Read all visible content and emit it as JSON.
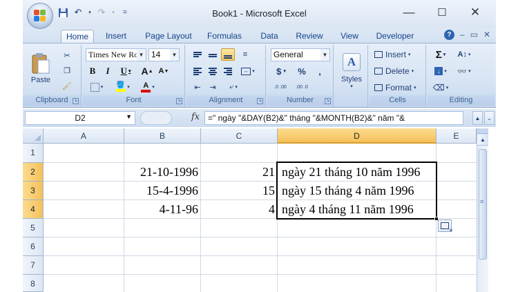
{
  "window": {
    "title": "Book1 - Microsoft Excel",
    "minimize": "—",
    "maximize": "☐",
    "close": "✕"
  },
  "quick_access": {
    "save_icon": "save-icon",
    "undo_icon": "undo-icon",
    "redo_icon": "redo-icon",
    "customize": "="
  },
  "tabs": [
    "Home",
    "Insert",
    "Page Layout",
    "Formulas",
    "Data",
    "Review",
    "View",
    "Developer"
  ],
  "active_tab": "Home",
  "ribbon_controls": {
    "help": "?",
    "minimize": "–",
    "restore": "▭",
    "close": "✕"
  },
  "ribbon": {
    "clipboard": {
      "label": "Clipboard",
      "paste": "Paste",
      "cut_icon": "cut-icon",
      "copy_icon": "copy-icon",
      "format_painter_icon": "format-painter-icon"
    },
    "font": {
      "label": "Font",
      "font_name": "Times New Ro",
      "font_size": "14",
      "bold": "B",
      "italic": "I",
      "underline": "U",
      "grow": "A",
      "shrink": "A"
    },
    "alignment": {
      "label": "Alignment"
    },
    "number": {
      "label": "Number",
      "format": "General",
      "currency": "$",
      "percent": "%",
      "comma": ",",
      "inc_decimal": ".0 .00",
      "dec_decimal": ".00 .0"
    },
    "styles": {
      "label": "Styles"
    },
    "cells": {
      "label": "Cells",
      "insert": "Insert",
      "delete": "Delete",
      "format": "Format"
    },
    "editing": {
      "label": "Editing",
      "sum": "Σ"
    }
  },
  "formula_bar": {
    "name_box": "D2",
    "fx": "fx",
    "formula": "=\" ngày \"&DAY(B2)&\" tháng \"&MONTH(B2)&\" năm \"&"
  },
  "grid": {
    "columns": [
      "A",
      "B",
      "C",
      "D",
      "E"
    ],
    "rows": [
      "1",
      "2",
      "3",
      "4",
      "5",
      "6",
      "7",
      "8"
    ],
    "selected_column": "D",
    "selected_rows": [
      "2",
      "3",
      "4"
    ],
    "cells": {
      "B2": "21-10-1996",
      "C2": "21",
      "D2": "ngày 21 tháng 10 năm 1996",
      "B3": "15-4-1996",
      "C3": "15",
      "D3": "ngày 15 tháng 4 năm 1996",
      "B4": "4-11-96",
      "C4": "4",
      "D4": "ngày 4 tháng 11 năm 1996"
    }
  },
  "colors": {
    "ribbon_text": "#15428b",
    "selection_header": "#f6c05a",
    "grid_line": "#d0d7e5"
  }
}
